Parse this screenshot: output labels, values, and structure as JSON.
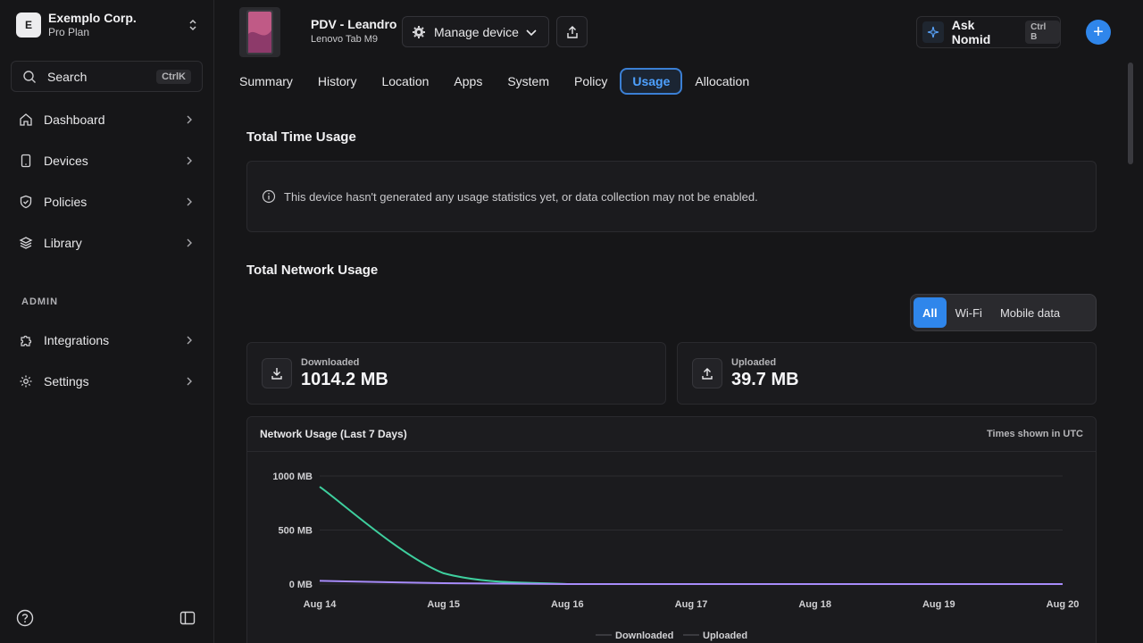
{
  "org": {
    "initial": "E",
    "name": "Exemplo Corp.",
    "plan": "Pro Plan"
  },
  "search": {
    "label": "Search",
    "shortcut": "CtrlK"
  },
  "sidebar": {
    "items": [
      {
        "label": "Dashboard",
        "icon": "home-icon"
      },
      {
        "label": "Devices",
        "icon": "device-icon"
      },
      {
        "label": "Policies",
        "icon": "shield-icon"
      },
      {
        "label": "Library",
        "icon": "layers-icon"
      }
    ],
    "admin_heading": "ADMIN",
    "admin_items": [
      {
        "label": "Integrations",
        "icon": "puzzle-icon"
      },
      {
        "label": "Settings",
        "icon": "gear-icon"
      }
    ]
  },
  "device": {
    "name": "PDV - Leandro",
    "model": "Lenovo Tab M9"
  },
  "toolbar": {
    "manage_label": "Manage device",
    "ask_label": "Ask Nomid",
    "ask_shortcut": "Ctrl B",
    "plus_label": "+"
  },
  "tabs": [
    {
      "label": "Summary"
    },
    {
      "label": "History"
    },
    {
      "label": "Location"
    },
    {
      "label": "Apps"
    },
    {
      "label": "System"
    },
    {
      "label": "Policy"
    },
    {
      "label": "Usage",
      "active": true
    },
    {
      "label": "Allocation"
    }
  ],
  "time_usage": {
    "title": "Total Time Usage",
    "notice": "This device hasn't generated any usage statistics yet, or data collection may not be enabled."
  },
  "network_usage": {
    "title": "Total Network Usage",
    "filters": [
      "All",
      "Wi-Fi",
      "Mobile data"
    ],
    "active_filter": "All",
    "downloaded_label": "Downloaded",
    "downloaded_value": "1014.2 MB",
    "uploaded_label": "Uploaded",
    "uploaded_value": "39.7 MB"
  },
  "chart_panel": {
    "title": "Network Usage (Last 7 Days)",
    "timezone_note": "Times shown in UTC"
  },
  "chart_data": {
    "type": "line",
    "x": [
      "Aug 14",
      "Aug 15",
      "Aug 16",
      "Aug 17",
      "Aug 18",
      "Aug 19",
      "Aug 20"
    ],
    "series": [
      {
        "name": "Downloaded",
        "values": [
          900,
          100,
          0,
          0,
          0,
          0,
          0
        ],
        "color": "#3ecf9e"
      },
      {
        "name": "Uploaded",
        "values": [
          30,
          8,
          0,
          0,
          0,
          0,
          0
        ],
        "color": "#a78bfa"
      }
    ],
    "yticks": [
      "0 MB",
      "500 MB",
      "1000 MB"
    ],
    "ytick_values": [
      0,
      500,
      1000
    ],
    "ylim": [
      0,
      1000
    ],
    "grid": true,
    "legend": "bottom"
  },
  "colors": {
    "accent": "#2f86eb",
    "active_tab": "#4ea1ff"
  }
}
